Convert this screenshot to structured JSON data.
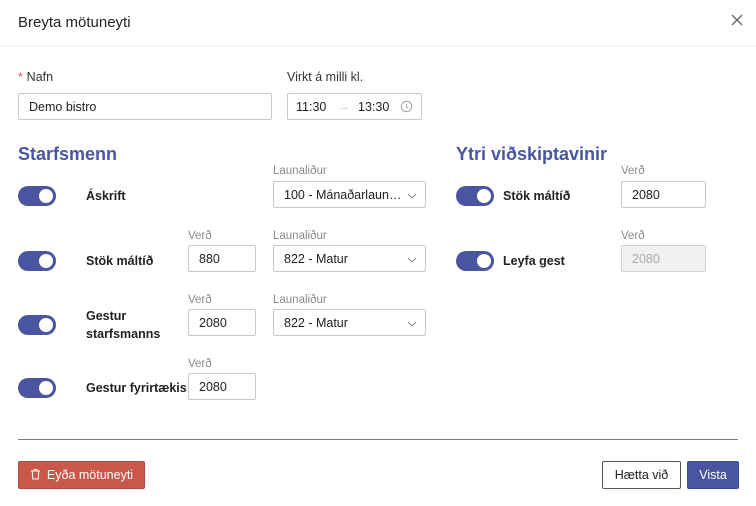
{
  "dialog": {
    "title": "Breyta mötuneyti"
  },
  "form": {
    "name_label": "Nafn",
    "required_mark": "*",
    "name_value": "Demo bistro",
    "time_label": "Virkt á milli kl.",
    "time_from": "11:30",
    "time_arrow": "→",
    "time_to": "13:30"
  },
  "staff": {
    "heading": "Starfsmenn",
    "rows": [
      {
        "label": "Áskrift",
        "on": true,
        "pay_label": "Launaliður",
        "pay_value": "100 - Mánaðarlaun /..."
      },
      {
        "label": "Stök máltíð",
        "on": true,
        "price_label": "Verð",
        "price": "880",
        "pay_label": "Launaliður",
        "pay_value": "822 - Matur"
      },
      {
        "label_line1": "Gestur",
        "label_line2": "starfsmanns",
        "on": true,
        "price_label": "Verð",
        "price": "2080",
        "pay_label": "Launaliður",
        "pay_value": "822 - Matur"
      },
      {
        "label": "Gestur fyrirtækis",
        "on": true,
        "price_label": "Verð",
        "price": "2080"
      }
    ]
  },
  "external": {
    "heading": "Ytri viðskiptavinir",
    "rows": [
      {
        "label": "Stök máltíð",
        "on": true,
        "price_label": "Verð",
        "price": "2080"
      },
      {
        "label": "Leyfa gest",
        "on": true,
        "price_label": "Verð",
        "price": "2080",
        "disabled": true
      }
    ]
  },
  "footer": {
    "delete_label": "Eyða mötuneyti",
    "cancel_label": "Hætta við",
    "save_label": "Vista"
  },
  "colors": {
    "accent": "#4a55a2",
    "danger": "#c9574a"
  },
  "icons": [
    "close-icon",
    "clock-icon",
    "chevron-down-icon",
    "trash-icon"
  ]
}
